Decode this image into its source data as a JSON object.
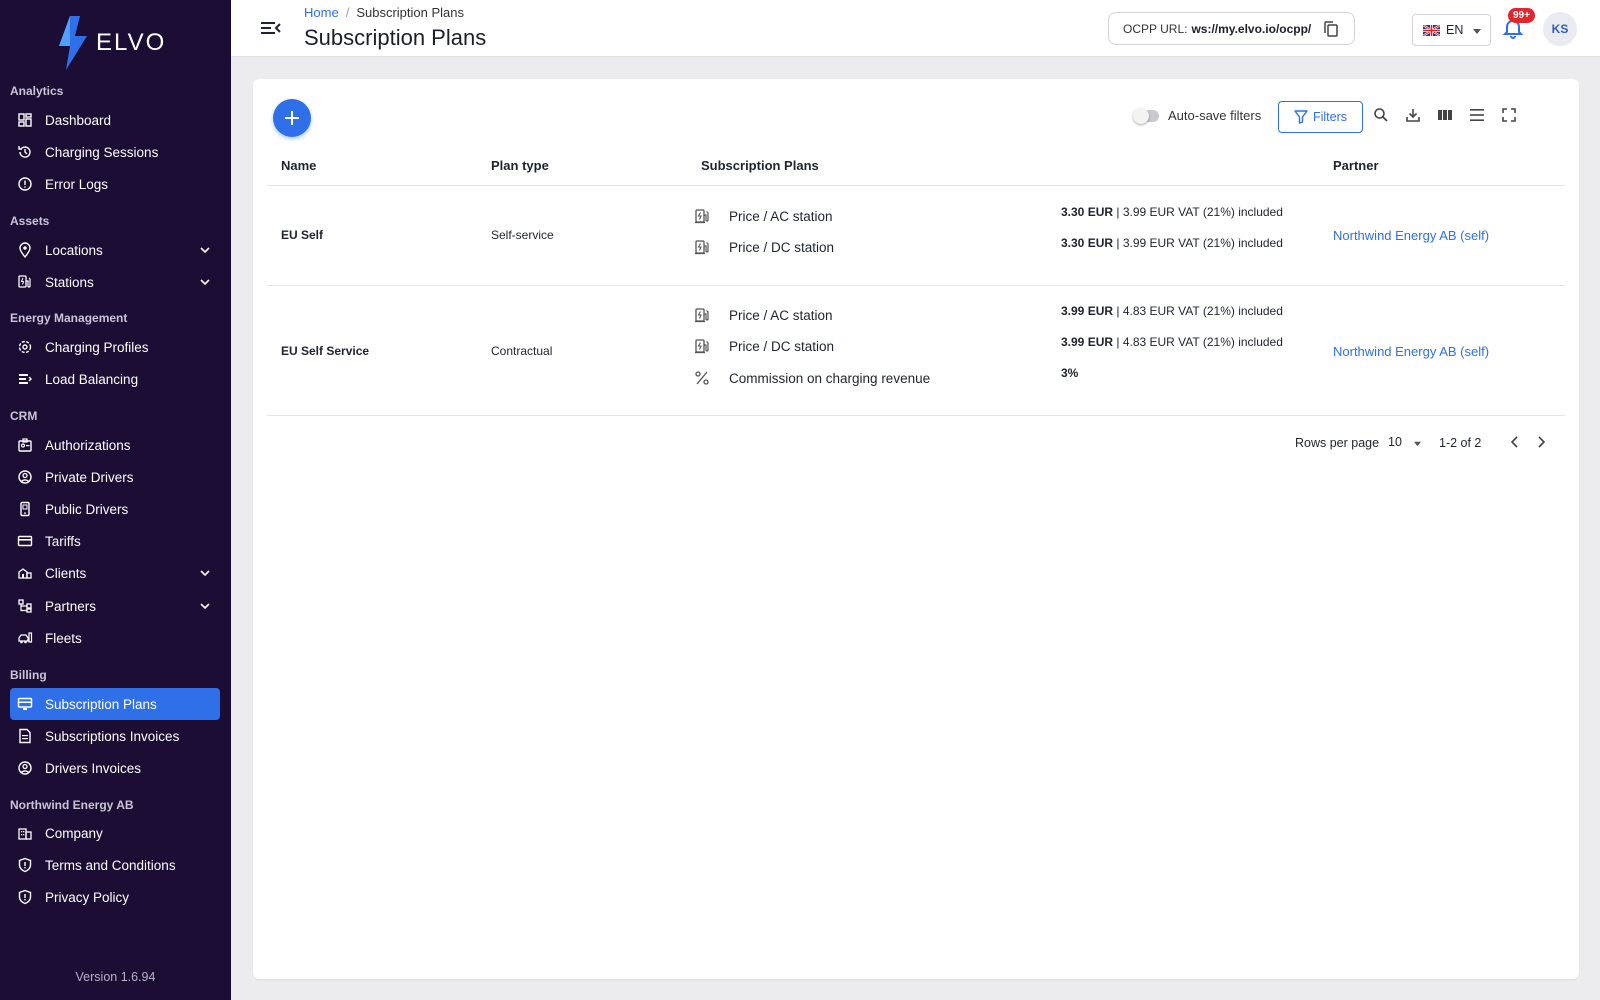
{
  "app": {
    "brand": "ELVO",
    "version": "Version 1.6.94"
  },
  "sidebar": {
    "sections": [
      {
        "title": "Analytics",
        "items": [
          {
            "label": "Dashboard",
            "icon": "dashboard-icon"
          },
          {
            "label": "Charging Sessions",
            "icon": "history-icon"
          },
          {
            "label": "Error Logs",
            "icon": "alert-circle-icon"
          }
        ]
      },
      {
        "title": "Assets",
        "items": [
          {
            "label": "Locations",
            "icon": "location-pin-icon",
            "expandable": true
          },
          {
            "label": "Stations",
            "icon": "ev-station-icon",
            "expandable": true
          }
        ]
      },
      {
        "title": "Energy Management",
        "items": [
          {
            "label": "Charging Profiles",
            "icon": "profile-cog-icon"
          },
          {
            "label": "Load Balancing",
            "icon": "load-balance-icon"
          }
        ]
      },
      {
        "title": "CRM",
        "items": [
          {
            "label": "Authorizations",
            "icon": "id-badge-icon"
          },
          {
            "label": "Private Drivers",
            "icon": "user-circle-icon"
          },
          {
            "label": "Public Drivers",
            "icon": "phone-device-icon"
          },
          {
            "label": "Tariffs",
            "icon": "credit-card-icon"
          },
          {
            "label": "Clients",
            "icon": "client-icon",
            "expandable": true
          },
          {
            "label": "Partners",
            "icon": "partners-icon",
            "expandable": true
          },
          {
            "label": "Fleets",
            "icon": "fleet-icon"
          }
        ]
      },
      {
        "title": "Billing",
        "items": [
          {
            "label": "Subscription Plans",
            "icon": "monitor-icon",
            "active": true
          },
          {
            "label": "Subscriptions Invoices",
            "icon": "invoice-icon"
          },
          {
            "label": "Drivers Invoices",
            "icon": "user-circle-icon"
          }
        ]
      },
      {
        "title": "Northwind Energy AB",
        "items": [
          {
            "label": "Company",
            "icon": "building-icon"
          },
          {
            "label": "Terms and Conditions",
            "icon": "shield-icon"
          },
          {
            "label": "Privacy Policy",
            "icon": "shield-icon"
          }
        ]
      }
    ]
  },
  "header": {
    "breadcrumb": {
      "home": "Home",
      "separator": "/",
      "current": "Subscription Plans"
    },
    "title": "Subscription Plans",
    "ocpp": {
      "label": "OCPP URL:",
      "url": "ws://my.elvo.io/ocpp/"
    },
    "language": "EN",
    "notifications_badge": "99+",
    "user_initials": "KS"
  },
  "toolbar": {
    "auto_save_label": "Auto-save filters",
    "auto_save_on": false,
    "filters_label": "Filters",
    "tools": [
      "search-icon",
      "download-icon",
      "columns-icon",
      "density-icon",
      "fullscreen-icon"
    ]
  },
  "table": {
    "columns": [
      "Name",
      "Plan type",
      "Subscription Plans",
      "Partner"
    ],
    "rows": [
      {
        "name": "EU Self",
        "plan_type": "Self-service",
        "partner": "Northwind Energy AB (self)",
        "plans": [
          {
            "icon": "ev-station-icon",
            "label": "Price / AC station",
            "price": "3.30 EUR",
            "detail": " | 3.99 EUR VAT (21%) included"
          },
          {
            "icon": "ev-station-icon",
            "label": "Price / DC station",
            "price": "3.30 EUR",
            "detail": " | 3.99 EUR VAT (21%) included"
          }
        ]
      },
      {
        "name": "EU Self Service",
        "plan_type": "Contractual",
        "partner": "Northwind Energy AB (self)",
        "plans": [
          {
            "icon": "ev-station-icon",
            "label": "Price / AC station",
            "price": "3.99 EUR",
            "detail": " | 4.83 EUR VAT (21%) included"
          },
          {
            "icon": "ev-station-icon",
            "label": "Price / DC station",
            "price": "3.99 EUR",
            "detail": " | 4.83 EUR VAT (21%) included"
          },
          {
            "icon": "percent-icon",
            "label": "Commission on charging revenue",
            "price": "3%",
            "detail": ""
          }
        ]
      }
    ]
  },
  "pagination": {
    "rows_per_page_label": "Rows per page",
    "rows_per_page": "10",
    "range": "1-2 of 2"
  },
  "colors": {
    "sidebar_bg": "#1b0d34",
    "accent": "#2f6fe8",
    "badge": "#e1262e"
  }
}
